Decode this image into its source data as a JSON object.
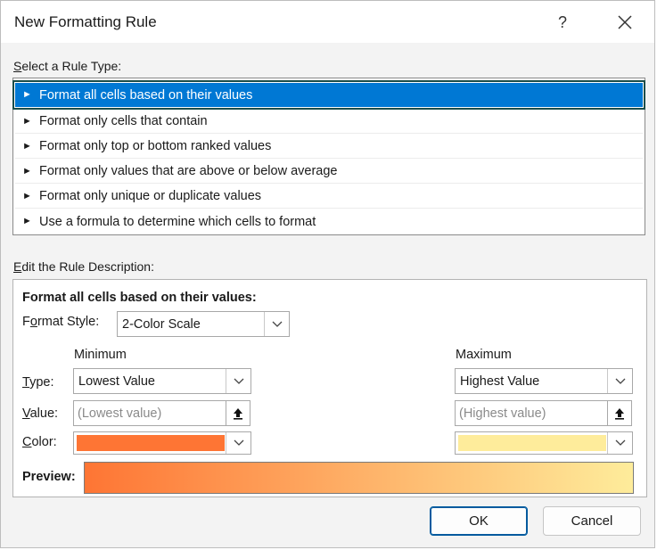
{
  "window": {
    "title": "New Formatting Rule",
    "help_glyph": "?"
  },
  "select_rule_type": {
    "label_first": "S",
    "label_rest": "elect a Rule Type:",
    "items": [
      {
        "label": "Format all cells based on their values",
        "selected": true
      },
      {
        "label": "Format only cells that contain",
        "selected": false
      },
      {
        "label": "Format only top or bottom ranked values",
        "selected": false
      },
      {
        "label": "Format only values that are above or below average",
        "selected": false
      },
      {
        "label": "Format only unique or duplicate values",
        "selected": false
      },
      {
        "label": "Use a formula to determine which cells to format",
        "selected": false
      }
    ]
  },
  "rule_description": {
    "label_first": "E",
    "label_rest": "dit the Rule Description:",
    "heading": "Format all cells based on their values:",
    "format_style": {
      "label_pre": "F",
      "label_u": "o",
      "label_post": "rmat Style:",
      "value": "2-Color Scale"
    },
    "minimum_header": "Minimum",
    "maximum_header": "Maximum",
    "type_label": {
      "u": "T",
      "rest": "ype:"
    },
    "value_label": {
      "u": "V",
      "rest": "alue:"
    },
    "color_label": {
      "u": "C",
      "rest": "olor:"
    },
    "min": {
      "type": "Lowest Value",
      "value_placeholder": "(Lowest value)",
      "color": "#fe7534"
    },
    "max": {
      "type": "Highest Value",
      "value_placeholder": "(Highest value)",
      "color": "#feec9b"
    },
    "preview_label": "Preview:"
  },
  "buttons": {
    "ok": "OK",
    "cancel": "Cancel"
  },
  "colors": {
    "accent": "#0078d4",
    "selection_outline": "#1b4d4a"
  }
}
